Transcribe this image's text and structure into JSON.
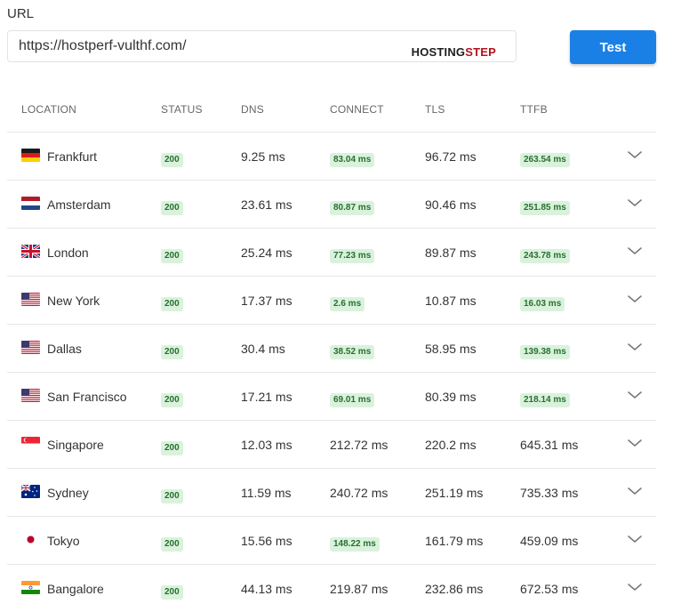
{
  "form": {
    "url_label": "URL",
    "url_value": "https://hostperf-vulthf.com/",
    "brand_part1": "HOSTING",
    "brand_part2": "STEP",
    "test_label": "Test"
  },
  "table": {
    "headers": [
      "LOCATION",
      "STATUS",
      "DNS",
      "CONNECT",
      "TLS",
      "TTFB"
    ],
    "rows": [
      {
        "location": "Frankfurt",
        "flag": "germany-flag",
        "status": "200",
        "dns": "9.25 ms",
        "connect": "83.04 ms",
        "connect_badge": true,
        "tls": "96.72 ms",
        "ttfb": "263.54 ms",
        "ttfb_badge": true
      },
      {
        "location": "Amsterdam",
        "flag": "netherlands-flag",
        "status": "200",
        "dns": "23.61 ms",
        "connect": "80.87 ms",
        "connect_badge": true,
        "tls": "90.46 ms",
        "ttfb": "251.85 ms",
        "ttfb_badge": true
      },
      {
        "location": "London",
        "flag": "uk-flag",
        "status": "200",
        "dns": "25.24 ms",
        "connect": "77.23 ms",
        "connect_badge": true,
        "tls": "89.87 ms",
        "ttfb": "243.78 ms",
        "ttfb_badge": true
      },
      {
        "location": "New York",
        "flag": "us-flag",
        "status": "200",
        "dns": "17.37 ms",
        "connect": "2.6 ms",
        "connect_badge": true,
        "tls": "10.87 ms",
        "ttfb": "16.03 ms",
        "ttfb_badge": true
      },
      {
        "location": "Dallas",
        "flag": "us-flag",
        "status": "200",
        "dns": "30.4 ms",
        "connect": "38.52 ms",
        "connect_badge": true,
        "tls": "58.95 ms",
        "ttfb": "139.38 ms",
        "ttfb_badge": true
      },
      {
        "location": "San Francisco",
        "flag": "us-flag",
        "status": "200",
        "dns": "17.21 ms",
        "connect": "69.01 ms",
        "connect_badge": true,
        "tls": "80.39 ms",
        "ttfb": "218.14 ms",
        "ttfb_badge": true
      },
      {
        "location": "Singapore",
        "flag": "singapore-flag",
        "status": "200",
        "dns": "12.03 ms",
        "connect": "212.72 ms",
        "connect_badge": false,
        "tls": "220.2 ms",
        "ttfb": "645.31 ms",
        "ttfb_badge": false
      },
      {
        "location": "Sydney",
        "flag": "australia-flag",
        "status": "200",
        "dns": "11.59 ms",
        "connect": "240.72 ms",
        "connect_badge": false,
        "tls": "251.19 ms",
        "ttfb": "735.33 ms",
        "ttfb_badge": false
      },
      {
        "location": "Tokyo",
        "flag": "japan-flag",
        "status": "200",
        "dns": "15.56 ms",
        "connect": "148.22 ms",
        "connect_badge": true,
        "tls": "161.79 ms",
        "ttfb": "459.09 ms",
        "ttfb_badge": false
      },
      {
        "location": "Bangalore",
        "flag": "india-flag",
        "status": "200",
        "dns": "44.13 ms",
        "connect": "219.87 ms",
        "connect_badge": false,
        "tls": "232.86 ms",
        "ttfb": "672.53 ms",
        "ttfb_badge": false
      }
    ]
  },
  "colors": {
    "accent": "#1a80e6",
    "badge_bg": "#d9f2dc",
    "badge_text": "#2a6e31",
    "brand_red": "#b3121d"
  }
}
